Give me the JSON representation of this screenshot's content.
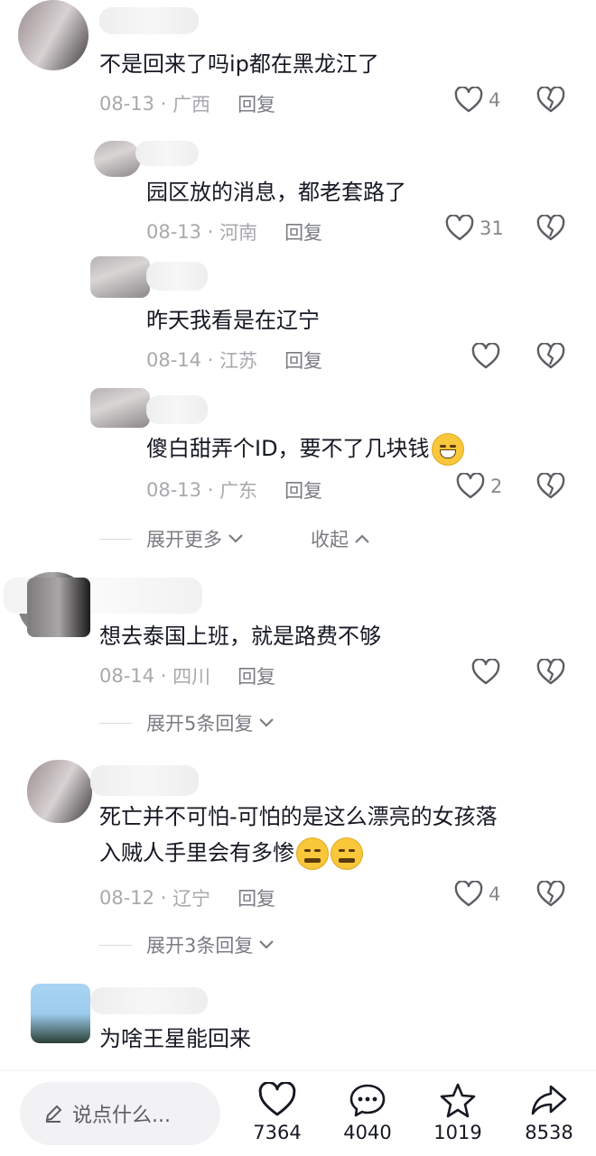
{
  "comments": [
    {
      "text": "不是回来了吗ip都在黑龙江了",
      "date": "08-13",
      "location": "广西",
      "reply_label": "回复",
      "likes": "4"
    },
    {
      "text": "园区放的消息，都老套路了",
      "date": "08-13",
      "location": "河南",
      "reply_label": "回复",
      "likes": "31"
    },
    {
      "text": "昨天我看是在辽宁",
      "date": "08-14",
      "location": "江苏",
      "reply_label": "回复",
      "likes": ""
    },
    {
      "text": "傻白甜弄个ID，要不了几块钱",
      "date": "08-13",
      "location": "广东",
      "reply_label": "回复",
      "likes": "2"
    },
    {
      "text": "想去泰国上班，就是路费不够",
      "date": "08-14",
      "location": "四川",
      "reply_label": "回复",
      "likes": ""
    },
    {
      "text_line1": "死亡并不可怕-可怕的是这么漂亮的女孩落",
      "text_line2": "入贼人手里会有多惨",
      "date": "08-12",
      "location": "辽宁",
      "reply_label": "回复",
      "likes": "4"
    },
    {
      "text": "为啥王星能回来"
    }
  ],
  "reply_controls": {
    "expand_more": "展开更多",
    "collapse": "收起",
    "expand_5": "展开5条回复",
    "expand_3": "展开3条回复"
  },
  "bottom_bar": {
    "input_placeholder": "说点什么...",
    "like_count": "7364",
    "comment_count": "4040",
    "favorite_count": "1019",
    "share_count": "8538"
  },
  "icons": {
    "like": "heart-outline-icon",
    "dislike": "broken-heart-icon",
    "comment": "chat-bubble-icon",
    "favorite": "star-icon",
    "share": "share-arrow-icon",
    "edit": "pencil-icon"
  },
  "colors": {
    "text_primary": "#161823",
    "text_meta": "#a8a9ad",
    "background": "#ffffff"
  }
}
